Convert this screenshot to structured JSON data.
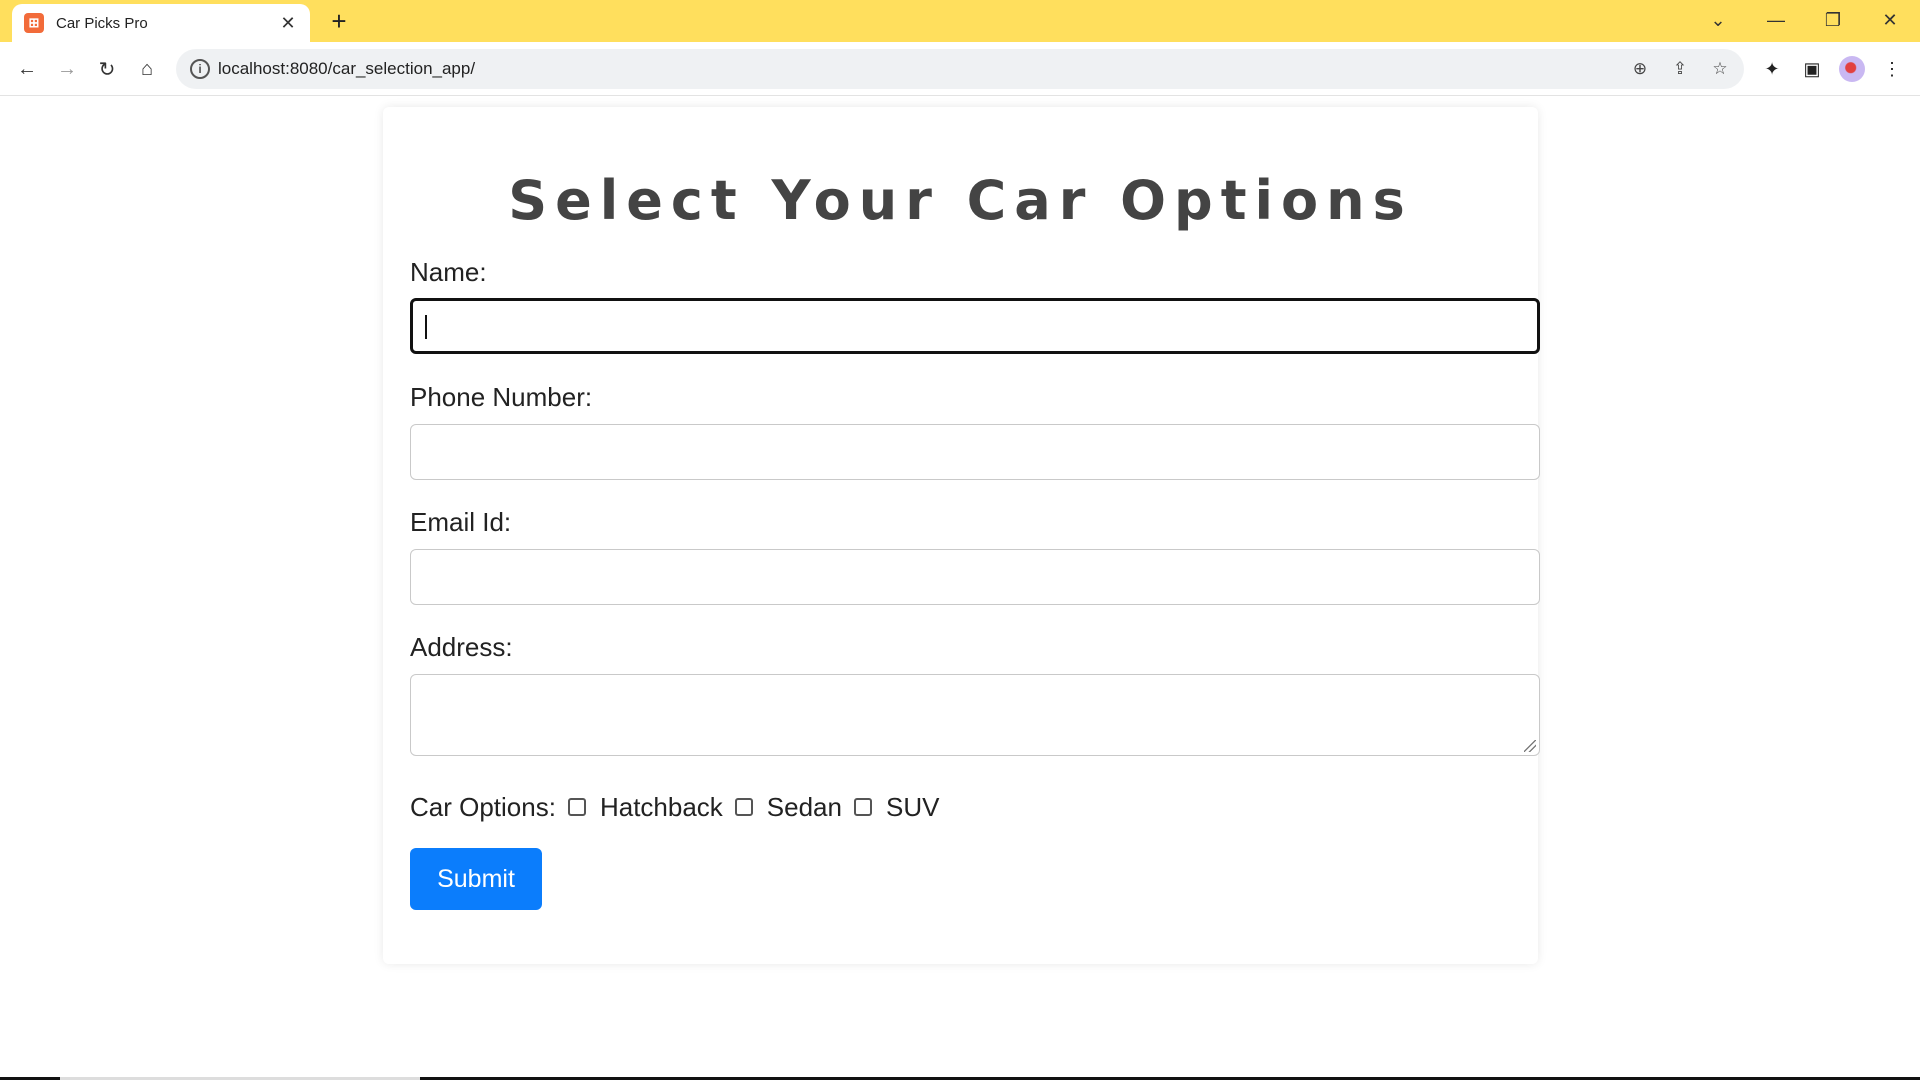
{
  "browser": {
    "tab_title": "Car Picks Pro",
    "tab_close": "✕",
    "new_tab": "+",
    "url": "localhost:8080/car_selection_app/",
    "window_controls": [
      "chevron-down-icon",
      "minimize-icon",
      "restore-icon",
      "close-icon"
    ]
  },
  "page": {
    "title": "Select Your Car Options",
    "name_label": "Name:",
    "phone_label": "Phone Number:",
    "email_label": "Email Id:",
    "address_label": "Address:",
    "car_options_label": "Car Options:",
    "options": [
      "Hatchback",
      "Sedan",
      "SUV"
    ],
    "submit_label": "Submit"
  },
  "colors": {
    "tabbar": "#ffdf5d",
    "submit": "#0b7dfc"
  }
}
